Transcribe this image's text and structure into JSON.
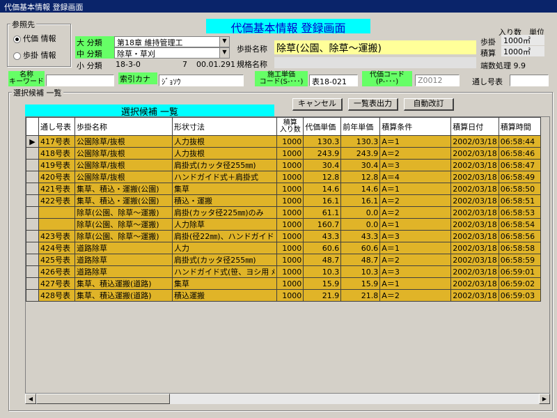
{
  "window": {
    "title": "代価基本情報 登録画面"
  },
  "reference": {
    "label": "参照先",
    "options": [
      {
        "label": "代価 情報",
        "selected": true
      },
      {
        "label": "歩掛 情報",
        "selected": false
      }
    ]
  },
  "header": {
    "title": "代価基本情報 登録画面"
  },
  "classification": {
    "major_label": "大 分類",
    "major_value": "第18章 維持管理工",
    "middle_label": "中 分類",
    "middle_value": "除草・草刈",
    "minor_label": "小 分類",
    "minor_code": "18-3-0",
    "minor_number": "7",
    "minor_version": "00.01.291"
  },
  "ayukake": {
    "name_label": "歩掛名称",
    "name_value": "除草(公園、除草～運搬)",
    "spec_label": "規格名称",
    "spec_value": ""
  },
  "units": {
    "qty_label": "入り数",
    "unit_label": "単位",
    "ayukake_label": "歩掛",
    "ayukake_value": "1000㎡",
    "sekisan_label": "積算",
    "sekisan_value": "1000㎡",
    "rounding_label": "端数処理",
    "rounding_value": "9.9"
  },
  "search": {
    "keyword_label_1": "名称",
    "keyword_label_2": "キーワード",
    "keyword_value": "",
    "kana_label": "索引カナ",
    "kana_value": "ｼﾞｮｿｳ",
    "code_label_1": "施工単価",
    "code_label_2": "コード(S-･･･)",
    "code_value": "表18-021",
    "daika_label_1": "代価コード",
    "daika_label_2": "(P-･･･)",
    "daika_value": "Z0012",
    "tooshi_label": "通し号表",
    "tooshi_value": ""
  },
  "candidates": {
    "group_label": "選択候補 一覧",
    "list_title": "選択候補 一覧",
    "cancel_button": "キャンセル",
    "print_button": "一覧表出力",
    "auto_button": "自動改訂",
    "current_marker": "▶",
    "columns": [
      "通し号表",
      "歩掛名称",
      "形状寸法",
      "積算\n入り数",
      "代価単価",
      "前年単価",
      "積算条件",
      "積算日付",
      "積算時間"
    ],
    "rows": [
      [
        "417号表",
        "公園除草/抜根",
        "人力抜根",
        "1000",
        "130.3",
        "130.3",
        "A＝1",
        "2002/03/18",
        "06:58:44"
      ],
      [
        "418号表",
        "公園除草/抜根",
        "人力抜根",
        "1000",
        "243.9",
        "243.9",
        "A＝2",
        "2002/03/18",
        "06:58:46"
      ],
      [
        "419号表",
        "公園除草/抜根",
        "肩掛式(カッタ径255㎜)",
        "1000",
        "30.4",
        "30.4",
        "A＝3",
        "2002/03/18",
        "06:58:47"
      ],
      [
        "420号表",
        "公園除草/抜根",
        "ハンドガイド式＋肩掛式",
        "1000",
        "12.8",
        "12.8",
        "A＝4",
        "2002/03/18",
        "06:58:49"
      ],
      [
        "421号表",
        "集草、積込・運搬(公園)",
        "集草",
        "1000",
        "14.6",
        "14.6",
        "A＝1",
        "2002/03/18",
        "06:58:50"
      ],
      [
        "422号表",
        "集草、積込・運搬(公園)",
        "積込・運搬",
        "1000",
        "16.1",
        "16.1",
        "A＝2",
        "2002/03/18",
        "06:58:51"
      ],
      [
        "",
        "除草(公園、除草～運搬)",
        "肩掛(カッタ径225㎜)のみ",
        "1000",
        "61.1",
        "0.0",
        "A＝2",
        "2002/03/18",
        "06:58:53"
      ],
      [
        "",
        "除草(公園、除草～運搬)",
        "人力除草",
        "1000",
        "160.7",
        "0.0",
        "A＝1",
        "2002/03/18",
        "06:58:54"
      ],
      [
        "423号表",
        "除草(公園、除草～運搬)",
        "肩掛(径22㎜)、ハンドガイド",
        "1000",
        "43.3",
        "43.3",
        "A＝3",
        "2002/03/18",
        "06:58:56"
      ],
      [
        "424号表",
        "道路除草",
        "人力",
        "1000",
        "60.6",
        "60.6",
        "A＝1",
        "2002/03/18",
        "06:58:58"
      ],
      [
        "425号表",
        "道路除草",
        "肩掛式(カッタ径255㎜)",
        "1000",
        "48.7",
        "48.7",
        "A＝2",
        "2002/03/18",
        "06:58:59"
      ],
      [
        "426号表",
        "道路除草",
        "ハンドガイド式(笹、ヨシ用 ﾒ",
        "1000",
        "10.3",
        "10.3",
        "A＝3",
        "2002/03/18",
        "06:59:01"
      ],
      [
        "427号表",
        "集草、積込運搬(道路)",
        "集草",
        "1000",
        "15.9",
        "15.9",
        "A＝1",
        "2002/03/18",
        "06:59:02"
      ],
      [
        "428号表",
        "集草、積込運搬(道路)",
        "積込運搬",
        "1000",
        "21.9",
        "21.8",
        "A＝2",
        "2002/03/18",
        "06:59:03"
      ]
    ]
  }
}
